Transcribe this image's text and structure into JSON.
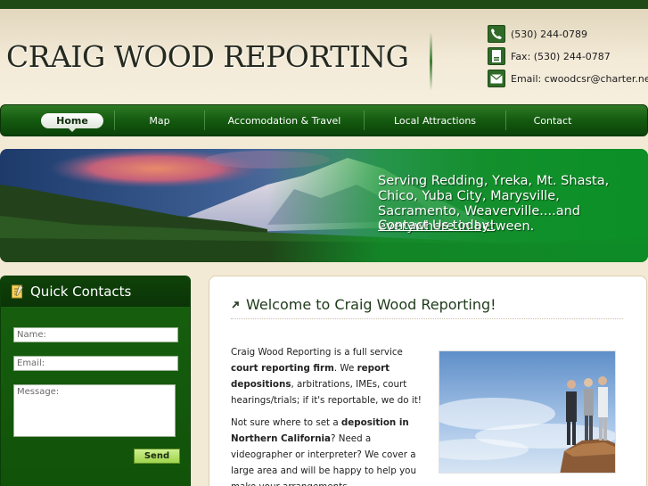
{
  "header": {
    "logo_text": "CRAIG WOOD REPORTING",
    "phone": "(530) 244-0789",
    "fax": "Fax: (530) 244-0787",
    "email": "Email: cwoodcsr@charter.net",
    "fax_icon_text": "FAX"
  },
  "nav": {
    "items": [
      {
        "label": "Home"
      },
      {
        "label": "Map"
      },
      {
        "label": "Accomodation & Travel"
      },
      {
        "label": "Local Attractions"
      },
      {
        "label": "Contact"
      }
    ]
  },
  "banner": {
    "text": "Serving Redding, Yreka, Mt. Shasta, Chico, Yuba City, Marysville, Sacramento, Weaverville....and everywhere in between.",
    "link": "Contact Us today!"
  },
  "sidebar": {
    "title": "Quick Contacts",
    "name_placeholder": "Name:",
    "email_placeholder": "Email:",
    "message_placeholder": "Message:",
    "send_label": "Send"
  },
  "main": {
    "title": "Welcome to Craig Wood Reporting!",
    "p1": [
      {
        "t": "Craig Wood Reporting is a full service ",
        "b": false
      },
      {
        "t": "court reporting firm",
        "b": true
      },
      {
        "t": ". We ",
        "b": false
      },
      {
        "t": "report depositions",
        "b": true
      },
      {
        "t": ", arbitrations, IMEs, court hearings/trials; if it's reportable, we do it!",
        "b": false
      }
    ],
    "p2": [
      {
        "t": "Not sure where to set a ",
        "b": false
      },
      {
        "t": "deposition in Northern California",
        "b": true
      },
      {
        "t": "? Need a videographer or interpreter? We cover a large area and will be happy to help you make your arrangements.",
        "b": false
      }
    ]
  },
  "colors": {
    "accent_green": "#145a10",
    "send_green": "#9fd44c",
    "background": "#f3ead6"
  }
}
